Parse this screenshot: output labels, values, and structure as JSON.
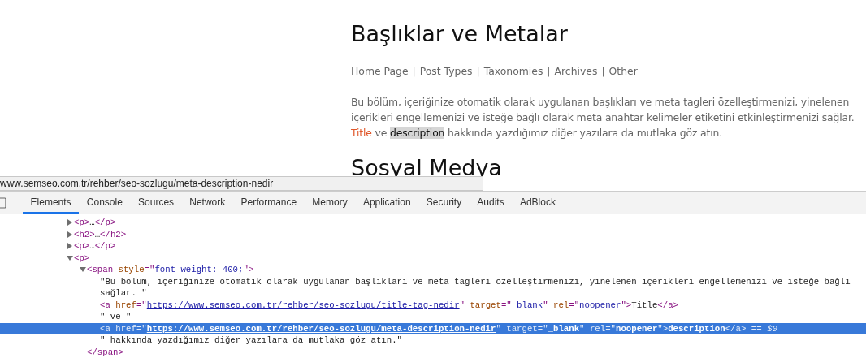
{
  "page": {
    "heading": "Başlıklar ve Metalar",
    "nav": {
      "separator": "|",
      "items": [
        "Home Page",
        "Post Types",
        "Taxonomies",
        "Archives",
        "Other"
      ]
    },
    "paragraph": [
      {
        "kind": "text",
        "text": "Bu bölüm, içeriğinize otomatik olarak uygulanan başlıkları ve meta tagleri özelleştirmenizi, yinelenen içerikleri engellemenizi ve isteğe bağlı olarak meta anahtar kelimeler etiketini etkinleştirmenizi sağlar. "
      },
      {
        "kind": "link",
        "text": "Title",
        "highlighted": false
      },
      {
        "kind": "text",
        "text": " ve "
      },
      {
        "kind": "link",
        "text": "description",
        "highlighted": true
      },
      {
        "kind": "text",
        "text": " hakkında yazdığımız diğer yazılara da mutlaka göz atın."
      }
    ],
    "next_heading": "Sosyal Medya"
  },
  "status_url": "www.semseo.com.tr/rehber/seo-sozlugu/meta-description-nedir",
  "devtools": {
    "tabs": [
      {
        "label": "Elements",
        "selected": true
      },
      {
        "label": "Console",
        "selected": false
      },
      {
        "label": "Sources",
        "selected": false
      },
      {
        "label": "Network",
        "selected": false
      },
      {
        "label": "Performance",
        "selected": false
      },
      {
        "label": "Memory",
        "selected": false
      },
      {
        "label": "Application",
        "selected": false
      },
      {
        "label": "Security",
        "selected": false
      },
      {
        "label": "Audits",
        "selected": false
      },
      {
        "label": "AdBlock",
        "selected": false
      }
    ],
    "tree": [
      {
        "expanded": false,
        "selected": false,
        "tokens": [
          {
            "kind": "tag",
            "text": "<p>"
          },
          {
            "kind": "text",
            "text": "…"
          },
          {
            "kind": "tag",
            "text": "</p>"
          }
        ]
      },
      {
        "expanded": false,
        "selected": false,
        "tokens": [
          {
            "kind": "tag",
            "text": "<h2>"
          },
          {
            "kind": "text",
            "text": "…"
          },
          {
            "kind": "tag",
            "text": "</h2>"
          }
        ]
      },
      {
        "expanded": false,
        "selected": false,
        "tokens": [
          {
            "kind": "tag",
            "text": "<p>"
          },
          {
            "kind": "text",
            "text": "…"
          },
          {
            "kind": "tag",
            "text": "</p>"
          }
        ]
      },
      {
        "expanded": true,
        "selected": false,
        "tokens": [
          {
            "kind": "tag",
            "text": "<p>"
          }
        ],
        "children": [
          {
            "expanded": true,
            "selected": false,
            "tokens": [
              {
                "kind": "tag",
                "text": "<span "
              },
              {
                "kind": "attr",
                "text": "style"
              },
              {
                "kind": "tag",
                "text": "=\""
              },
              {
                "kind": "value",
                "text": "font-weight: 400;"
              },
              {
                "kind": "tag",
                "text": "\">"
              }
            ],
            "closing": [
              {
                "kind": "tag",
                "text": "</span>"
              }
            ],
            "children": [
              {
                "selected": false,
                "tokens": [
                  {
                    "kind": "text",
                    "text": "\"Bu bölüm, içeriğinize otomatik olarak uygulanan başlıkları ve meta tagleri özelleştirmenizi, yinelenen içerikleri engellemenizi ve isteğe bağlı"
                  }
                ]
              },
              {
                "selected": false,
                "tokens": [
                  {
                    "kind": "text",
                    "text": "sağlar. \""
                  }
                ]
              },
              {
                "selected": false,
                "tokens": [
                  {
                    "kind": "tag",
                    "text": "<a "
                  },
                  {
                    "kind": "attr",
                    "text": "href"
                  },
                  {
                    "kind": "tag",
                    "text": "=\""
                  },
                  {
                    "kind": "link",
                    "text": "https://www.semseo.com.tr/rehber/seo-sozlugu/title-tag-nedir"
                  },
                  {
                    "kind": "tag",
                    "text": "\" "
                  },
                  {
                    "kind": "attr",
                    "text": "target"
                  },
                  {
                    "kind": "tag",
                    "text": "=\""
                  },
                  {
                    "kind": "value",
                    "text": "_blank"
                  },
                  {
                    "kind": "tag",
                    "text": "\" "
                  },
                  {
                    "kind": "attr",
                    "text": "rel"
                  },
                  {
                    "kind": "tag",
                    "text": "=\""
                  },
                  {
                    "kind": "value",
                    "text": "noopener"
                  },
                  {
                    "kind": "tag",
                    "text": "\">"
                  },
                  {
                    "kind": "text",
                    "text": "Title"
                  },
                  {
                    "kind": "tag",
                    "text": "</a>"
                  }
                ]
              },
              {
                "selected": false,
                "tokens": [
                  {
                    "kind": "text",
                    "text": "\" ve \""
                  }
                ]
              },
              {
                "selected": true,
                "tokens": [
                  {
                    "kind": "tag",
                    "text": "<a "
                  },
                  {
                    "kind": "attr",
                    "text": "href"
                  },
                  {
                    "kind": "tag",
                    "text": "=\""
                  },
                  {
                    "kind": "link",
                    "text": "https://www.semseo.com.tr/rehber/seo-sozlugu/meta-description-nedir"
                  },
                  {
                    "kind": "tag",
                    "text": "\" "
                  },
                  {
                    "kind": "attr",
                    "text": "target"
                  },
                  {
                    "kind": "tag",
                    "text": "=\""
                  },
                  {
                    "kind": "value",
                    "text": "_blank"
                  },
                  {
                    "kind": "tag",
                    "text": "\" "
                  },
                  {
                    "kind": "attr",
                    "text": "rel"
                  },
                  {
                    "kind": "tag",
                    "text": "=\""
                  },
                  {
                    "kind": "value",
                    "text": "noopener"
                  },
                  {
                    "kind": "tag",
                    "text": "\">"
                  },
                  {
                    "kind": "text",
                    "text": "description"
                  },
                  {
                    "kind": "tag",
                    "text": "</a>"
                  },
                  {
                    "kind": "marker",
                    "text": " == $0"
                  }
                ]
              },
              {
                "selected": false,
                "tokens": [
                  {
                    "kind": "text",
                    "text": "\" hakkında yazdığımız diğer yazılara da mutlaka göz atın.\""
                  }
                ]
              }
            ]
          }
        ]
      }
    ]
  }
}
